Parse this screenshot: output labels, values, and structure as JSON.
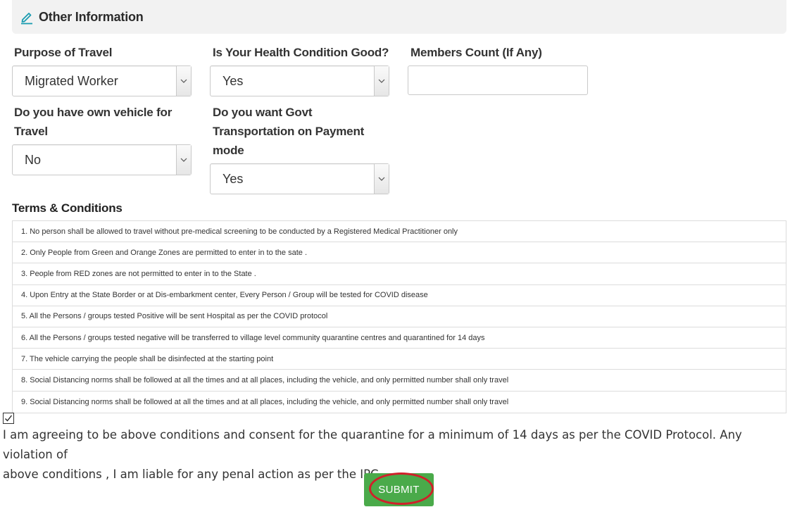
{
  "section": {
    "title": "Other Information",
    "icon": "edit-pencil-icon",
    "accent_color": "#1a9bb0"
  },
  "fields": {
    "purpose": {
      "label": "Purpose of Travel",
      "value": "Migrated Worker"
    },
    "health": {
      "label": "Is Your Health Condition Good?",
      "value": "Yes"
    },
    "members": {
      "label": "Members Count (If Any)",
      "value": "",
      "placeholder": ""
    },
    "vehicle": {
      "label_line1": "Do you have own vehicle for",
      "label_line2": "Travel",
      "value": "No"
    },
    "govt": {
      "label_line1": "Do you want Govt",
      "label_line2": "Transportation on Payment",
      "label_line3": "mode",
      "value": "Yes"
    }
  },
  "terms": {
    "title": "Terms & Conditions",
    "items": [
      "1. No person shall be allowed to travel without pre-medical screening to be conducted by a Registered Medical Practitioner only",
      "2. Only People from Green and Orange Zones are permitted to enter in to the sate .",
      "3. People from RED zones are not permitted to enter in to the State .",
      "4. Upon Entry at the State Border or at Dis-embarkment center, Every Person / Group will be tested for COVID disease",
      "5. All the Persons / groups tested Positive will be sent Hospital as per the COVID protocol",
      "6. All the Persons / groups tested negative will be transferred to village level community quarantine centres and quarantined for 14 days",
      "7. The vehicle carrying the people shall be disinfected at the starting point",
      "8. Social Distancing norms shall be followed at all the times and at all places, including the vehicle, and only permitted number shall only travel",
      "9. Social Distancing norms shall be followed at all the times and at all places, including the vehicle, and only permitted number shall only travel"
    ]
  },
  "consent": {
    "checked": true,
    "line1": "I am agreeing to be above conditions and consent for the quarantine for a minimum of 14 days as per the COVID Protocol. Any violation of",
    "line2": "above conditions , I am liable for any penal action as per the IPC"
  },
  "submit": {
    "label": "SUBMIT",
    "color": "#4aaa4a",
    "highlight_color": "#d0202a"
  }
}
